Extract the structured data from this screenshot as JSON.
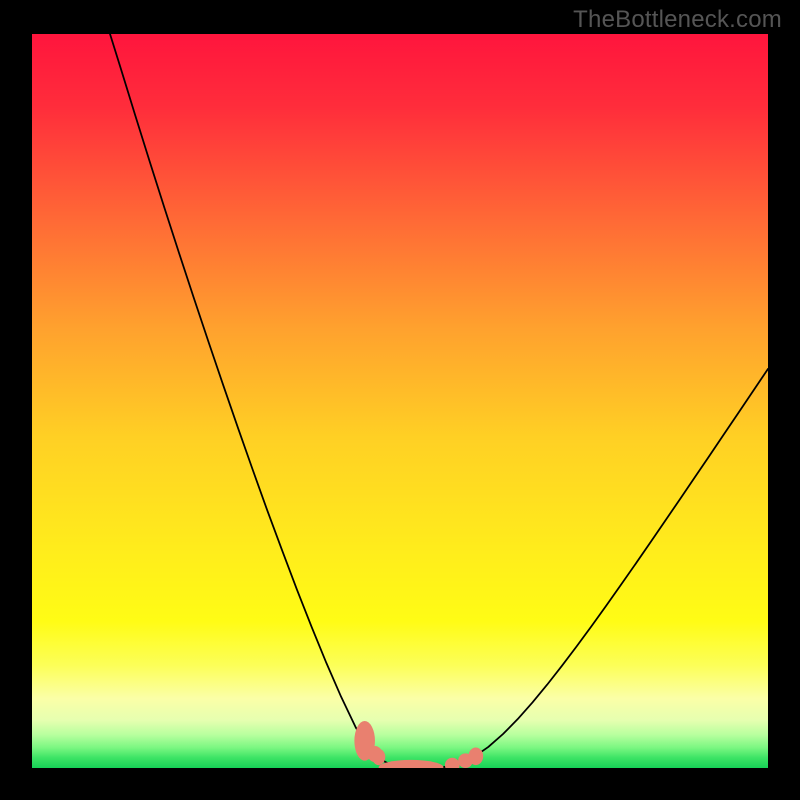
{
  "watermark": "TheBottleneck.com",
  "chart_data": {
    "type": "line",
    "title": "",
    "xlabel": "",
    "ylabel": "",
    "xlim": [
      0,
      100
    ],
    "ylim": [
      0,
      100
    ],
    "grid": false,
    "series": [
      {
        "name": "left-curve",
        "x": [
          10.6,
          12,
          14,
          16,
          18,
          20,
          22,
          24,
          26,
          28,
          30,
          32,
          34,
          36,
          38,
          40,
          42,
          44,
          45.2,
          46,
          47.2,
          47.5,
          48,
          48.5,
          49,
          49.5,
          50.5,
          52
        ],
        "y": [
          100,
          95.5,
          89.0,
          82.6,
          76.3,
          70.1,
          64.0,
          58.0,
          52.1,
          46.3,
          40.6,
          35.0,
          29.6,
          24.3,
          19.2,
          14.3,
          9.7,
          5.5,
          3.6,
          2.6,
          1.4,
          1.2,
          0.83,
          0.56,
          0.34,
          0.18,
          0,
          0
        ]
      },
      {
        "name": "right-curve",
        "x": [
          52,
          53,
          54,
          55,
          56,
          57,
          58,
          58.8,
          60,
          62,
          64,
          66,
          68,
          70,
          72,
          74,
          76,
          78,
          80,
          82,
          84,
          86,
          88,
          90,
          92,
          94,
          96,
          98,
          100
        ],
        "y": [
          0,
          0,
          0,
          0.038,
          0.142,
          0.315,
          0.573,
          0.872,
          1.47,
          2.87,
          4.63,
          6.67,
          8.93,
          11.36,
          13.92,
          16.57,
          19.3,
          22.09,
          24.93,
          27.8,
          30.7,
          33.63,
          36.57,
          39.52,
          42.48,
          45.45,
          48.42,
          51.4,
          54.37
        ]
      }
    ],
    "salmon_markers": {
      "note": "approximate positions of salmon-colored beads along the curve near the trough",
      "points": [
        {
          "x": 45.2,
          "y": 3.7,
          "rx": 1.4,
          "ry": 2.7
        },
        {
          "x": 46.6,
          "y": 1.9,
          "rx": 1.0,
          "ry": 1.1
        },
        {
          "x": 47.1,
          "y": 1.5,
          "rx": 0.9,
          "ry": 1.1
        },
        {
          "x": 51.5,
          "y": 0.1,
          "rx": 4.4,
          "ry": 1.0
        },
        {
          "x": 57.1,
          "y": 0.4,
          "rx": 1.0,
          "ry": 1.0
        },
        {
          "x": 58.9,
          "y": 1.0,
          "rx": 1.0,
          "ry": 1.0
        },
        {
          "x": 60.3,
          "y": 1.6,
          "rx": 1.0,
          "ry": 1.2
        }
      ]
    },
    "background_gradient": {
      "note": "vertical gradient from bright red at top through orange/yellow to green at bottom",
      "stops": [
        {
          "offset": 0.0,
          "color": "#ff153d"
        },
        {
          "offset": 0.1,
          "color": "#ff2d3b"
        },
        {
          "offset": 0.25,
          "color": "#ff6836"
        },
        {
          "offset": 0.4,
          "color": "#ffa12e"
        },
        {
          "offset": 0.55,
          "color": "#ffd024"
        },
        {
          "offset": 0.7,
          "color": "#ffec1c"
        },
        {
          "offset": 0.8,
          "color": "#fffc15"
        },
        {
          "offset": 0.86,
          "color": "#fcff58"
        },
        {
          "offset": 0.905,
          "color": "#fbffa7"
        },
        {
          "offset": 0.935,
          "color": "#e6ffb0"
        },
        {
          "offset": 0.955,
          "color": "#b7ff9e"
        },
        {
          "offset": 0.972,
          "color": "#7cf782"
        },
        {
          "offset": 0.986,
          "color": "#3de465"
        },
        {
          "offset": 1.0,
          "color": "#17d157"
        }
      ]
    }
  }
}
